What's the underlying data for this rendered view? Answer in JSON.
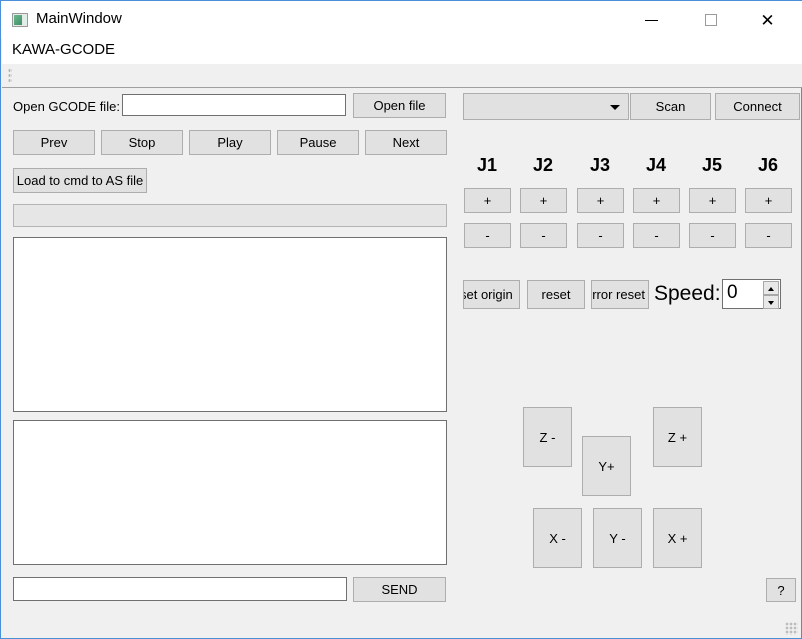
{
  "window": {
    "title": "MainWindow",
    "subtitle": "KAWA-GCODE",
    "icon": "app-icon",
    "minimize_label": "—",
    "maximize_label": "",
    "close_label": "✕"
  },
  "file_section": {
    "label": "Open GCODE file:",
    "path_value": "",
    "path_placeholder": "",
    "open_button": "Open file"
  },
  "playback_buttons": [
    {
      "label": "Prev",
      "name": "prev-button"
    },
    {
      "label": "Stop",
      "name": "stop-button"
    },
    {
      "label": "Play",
      "name": "play-button"
    },
    {
      "label": "Pause",
      "name": "pause-button"
    },
    {
      "label": "Next",
      "name": "next-button"
    }
  ],
  "load_button": {
    "label": "Load to cmd to AS file"
  },
  "progress": {
    "value": 0,
    "max": 100
  },
  "gcode_view": {
    "value": "",
    "placeholder": ""
  },
  "console_view": {
    "value": "",
    "placeholder": ""
  },
  "command_bar": {
    "input_value": "",
    "input_placeholder": "",
    "send_button": "SEND"
  },
  "connection": {
    "port_selected": "",
    "scan_button": "Scan",
    "connect_button": "Connect",
    "dropdown_icon": "chevron-down-icon"
  },
  "joints": {
    "labels": [
      "J1",
      "J2",
      "J3",
      "J4",
      "J5",
      "J6"
    ],
    "plus_label": "+",
    "minus_label": "-"
  },
  "robot_actions": {
    "set_origin": "set origin",
    "reset": "reset",
    "error_reset": "error reset"
  },
  "speed": {
    "label": "Speed:",
    "value": "0",
    "up_icon": "spinner-up-icon",
    "down_icon": "spinner-down-icon"
  },
  "jog": {
    "z_minus": "Z -",
    "y_plus": "Y+",
    "z_plus": "Z +",
    "x_minus": "X -",
    "y_minus": "Y -",
    "x_plus": "X +"
  },
  "help": {
    "label": "?"
  },
  "colors": {
    "window_border": "#4a90d9",
    "panel_background": "#f0f0f0",
    "button_face": "#e1e1e1",
    "button_border": "#adadad",
    "field_border": "#707070",
    "field_background": "#ffffff"
  }
}
